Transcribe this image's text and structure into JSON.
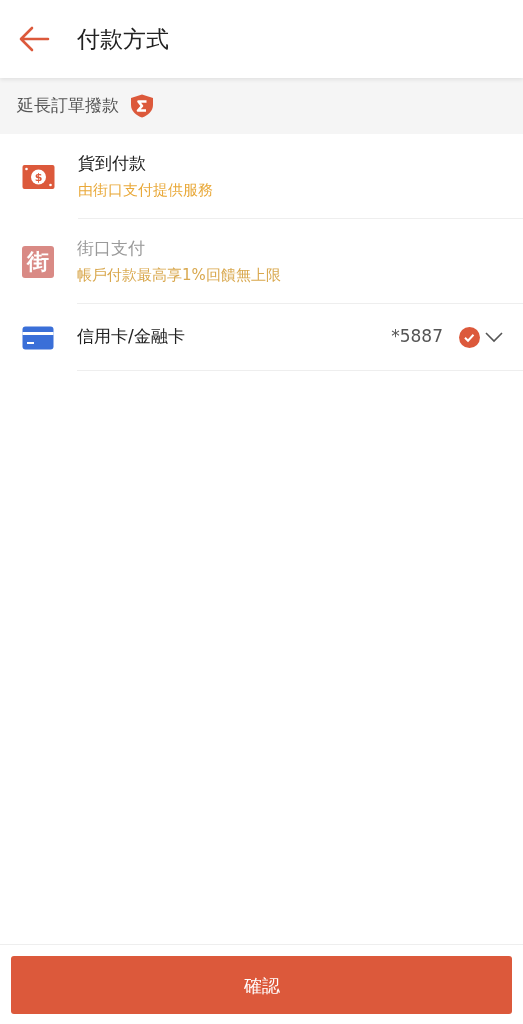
{
  "header": {
    "title": "付款方式"
  },
  "section": {
    "label": "延長訂單撥款"
  },
  "methods": [
    {
      "kind": "cash",
      "icon_text": "$",
      "name": "貨到付款",
      "note": "由街口支付提供服務",
      "disabled": false,
      "selected": false
    },
    {
      "kind": "wallet",
      "logo_text": "街",
      "name": "街口支付",
      "note": "帳戶付款最高享1%回饋無上限",
      "disabled": true,
      "selected": false
    },
    {
      "kind": "card",
      "name": "信用卡/金融卡",
      "card_number": "*5887",
      "disabled": false,
      "selected": true,
      "expanded": false
    }
  ],
  "confirm_button": "確認"
}
